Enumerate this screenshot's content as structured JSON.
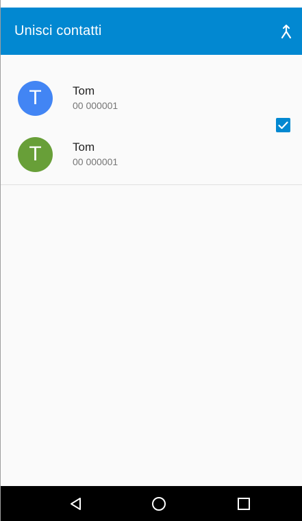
{
  "app_bar": {
    "title": "Unisci contatti",
    "action_icon": "merge-icon",
    "color": "#0288d1"
  },
  "contacts": [
    {
      "initial": "T",
      "name": "Tom",
      "phone": "00 000001",
      "avatar_color": "#4285f4"
    },
    {
      "initial": "T",
      "name": "Tom",
      "phone": "00 000001",
      "avatar_color": "#689f38"
    }
  ],
  "selection": {
    "checked": true,
    "icon": "checkbox-checked-icon"
  },
  "nav_bar": {
    "buttons": [
      "back-icon",
      "home-icon",
      "recents-icon"
    ]
  }
}
